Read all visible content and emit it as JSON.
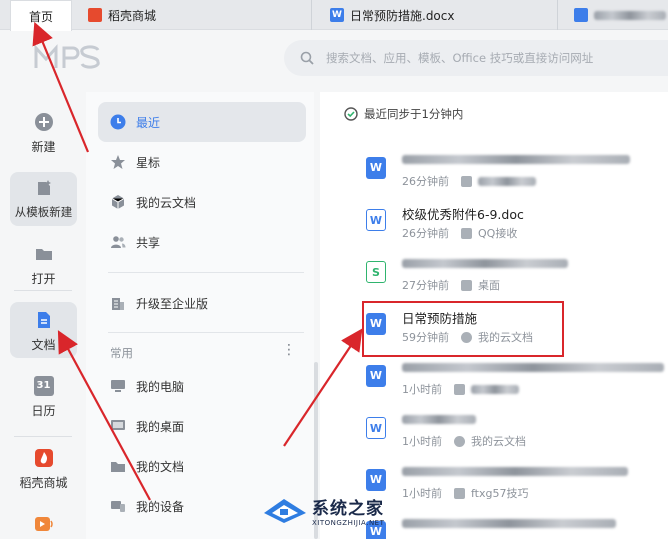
{
  "tabs": {
    "home": "首页",
    "store": "稻壳商城",
    "doc": "日常预防措施.docx"
  },
  "search": {
    "placeholder": "搜索文档、应用、模板、Office 技巧或直接访问网址"
  },
  "rail": {
    "new": "新建",
    "from_template": "从模板新建",
    "open": "打开",
    "docs": "文档",
    "calendar": "日历",
    "calendar_day": "31",
    "store": "稻壳商城"
  },
  "nav": {
    "recent": "最近",
    "starred": "星标",
    "cloud": "我的云文档",
    "shared": "共享",
    "upgrade": "升级至企业版",
    "section_common": "常用",
    "more": "⋮",
    "my_computer": "我的电脑",
    "my_desktop": "我的桌面",
    "my_docs": "我的文档",
    "my_devices": "我的设备"
  },
  "main": {
    "sync_status": "最近同步于1分钟内",
    "files": [
      {
        "icon": "word-solid-icon",
        "time": "26分钟前"
      },
      {
        "icon": "word-outline-icon",
        "name": "校级优秀附件6-9.doc",
        "time": "26分钟前",
        "source": "QQ接收"
      },
      {
        "icon": "sheet-outline-icon",
        "time": "27分钟前",
        "source": "桌面"
      },
      {
        "icon": "word-solid-icon",
        "name": "日常预防措施",
        "time": "59分钟前",
        "source": "我的云文档"
      },
      {
        "icon": "word-solid-icon",
        "time": "1小时前"
      },
      {
        "icon": "word-outline-icon",
        "time": "1小时前",
        "source": "我的云文档"
      },
      {
        "icon": "word-solid-icon",
        "time": "1小时前",
        "source": "ftxg57技巧"
      }
    ]
  },
  "watermark": {
    "cn": "系统之家",
    "en": "XITONGZHIJIA.NET"
  },
  "colors": {
    "accent": "#3d7eea",
    "highlight": "#d9262b",
    "arrow": "#d9262b"
  }
}
